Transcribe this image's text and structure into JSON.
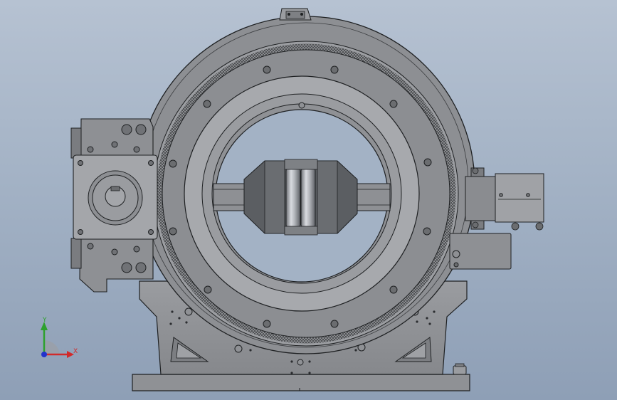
{
  "view": {
    "background_top": "#b6c2d2",
    "background_bottom": "#8e9fb6",
    "part_fill": "#8e9094",
    "part_fill_light": "#a7a9ad",
    "part_fill_dark": "#5e6165",
    "edge_color": "#1e2022"
  },
  "triad": {
    "x_label": "X",
    "y_label": "Y",
    "x_color": "#d12a2a",
    "y_color": "#2ea12e",
    "z_color": "#2233cc"
  }
}
